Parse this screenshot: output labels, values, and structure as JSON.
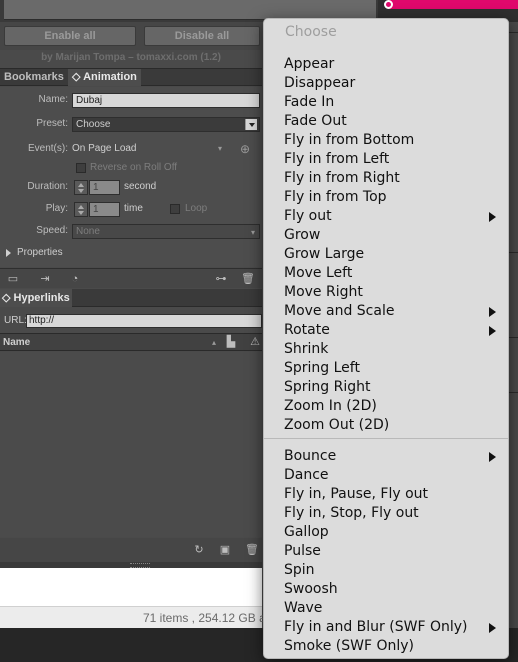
{
  "panel": {
    "enable_all": "Enable all",
    "disable_all": "Disable all",
    "credit": "by Marijan Tompa – tomaxxi.com (1.2)",
    "tabs": {
      "bookmarks": "Bookmarks",
      "animation": "◇ Animation"
    },
    "form": {
      "name_label": "Name:",
      "name_value": "Dubaj",
      "preset_label": "Preset:",
      "preset_value": "Choose",
      "events_label": "Event(s):",
      "events_value": "On Page Load",
      "reverse_label": "Reverse on Roll Off",
      "duration_label": "Duration:",
      "duration_value": "1",
      "duration_unit": "second",
      "play_label": "Play:",
      "play_value": "1",
      "play_unit": "time",
      "loop_label": "Loop",
      "speed_label": "Speed:",
      "speed_value": "None",
      "properties_label": "Properties"
    },
    "hyperlinks": {
      "tab": "◇ Hyperlinks",
      "url_label": "URL:",
      "url_value": "http://",
      "column_name": "Name"
    },
    "finder_status": "71 items , 254.12 GB a"
  },
  "menu": {
    "header": "Choose",
    "group1": [
      {
        "label": "Appear",
        "submenu": false
      },
      {
        "label": "Disappear",
        "submenu": false
      },
      {
        "label": "Fade In",
        "submenu": false
      },
      {
        "label": "Fade Out",
        "submenu": false
      },
      {
        "label": "Fly in from Bottom",
        "submenu": false
      },
      {
        "label": "Fly in from Left",
        "submenu": false
      },
      {
        "label": "Fly in from Right",
        "submenu": false
      },
      {
        "label": "Fly in from Top",
        "submenu": false
      },
      {
        "label": "Fly out",
        "submenu": true
      },
      {
        "label": "Grow",
        "submenu": false
      },
      {
        "label": "Grow Large",
        "submenu": false
      },
      {
        "label": "Move Left",
        "submenu": false
      },
      {
        "label": "Move Right",
        "submenu": false
      },
      {
        "label": "Move and Scale",
        "submenu": true
      },
      {
        "label": "Rotate",
        "submenu": true
      },
      {
        "label": "Shrink",
        "submenu": false
      },
      {
        "label": "Spring Left",
        "submenu": false
      },
      {
        "label": "Spring Right",
        "submenu": false
      },
      {
        "label": "Zoom In (2D)",
        "submenu": false
      },
      {
        "label": "Zoom Out (2D)",
        "submenu": false
      }
    ],
    "group2": [
      {
        "label": "Bounce",
        "submenu": true
      },
      {
        "label": "Dance",
        "submenu": false
      },
      {
        "label": "Fly in, Pause, Fly out",
        "submenu": false
      },
      {
        "label": "Fly in, Stop, Fly out",
        "submenu": false
      },
      {
        "label": "Gallop",
        "submenu": false
      },
      {
        "label": "Pulse",
        "submenu": false
      },
      {
        "label": "Spin",
        "submenu": false
      },
      {
        "label": "Swoosh",
        "submenu": false
      },
      {
        "label": "Wave",
        "submenu": false
      },
      {
        "label": "Fly in and Blur (SWF Only)",
        "submenu": true
      },
      {
        "label": "Smoke (SWF Only)",
        "submenu": false
      }
    ]
  }
}
